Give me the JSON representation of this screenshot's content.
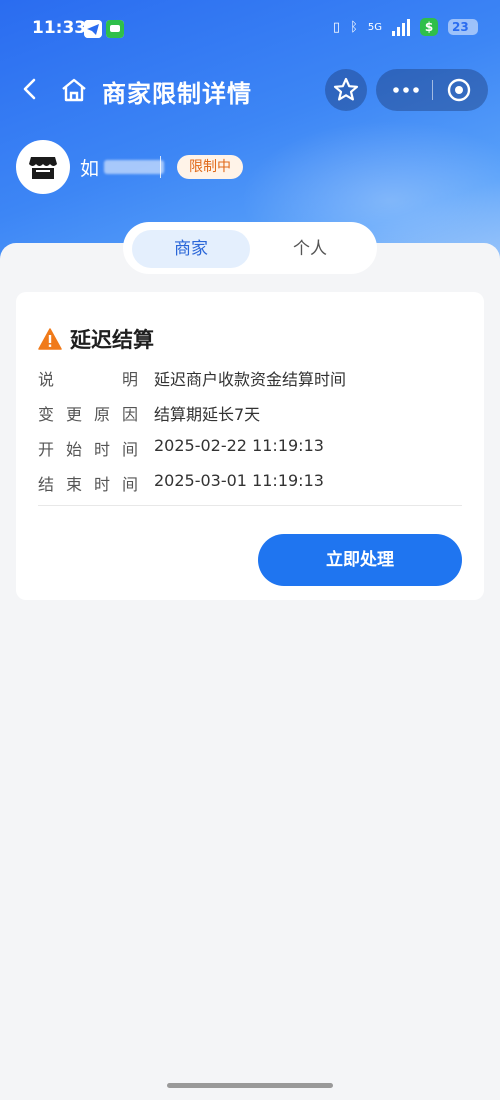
{
  "status": {
    "time": "11:33",
    "network": "5G",
    "battery": "23"
  },
  "nav": {
    "title": "商家限制详情"
  },
  "merchant": {
    "name_initial": "如",
    "restriction_tag": "限制中"
  },
  "tabs": [
    {
      "label": "商家",
      "active": true
    },
    {
      "label": "个人",
      "active": false
    }
  ],
  "card": {
    "title": "延迟结算",
    "rows": [
      {
        "label": [
          "说",
          "明"
        ],
        "value": "延迟商户收款资金结算时间"
      },
      {
        "label": [
          "变",
          "更",
          "原",
          "因"
        ],
        "value": "结算期延长7天"
      },
      {
        "label": [
          "开",
          "始",
          "时",
          "间"
        ],
        "value": "2025-02-22 11:19:13"
      },
      {
        "label": [
          "结",
          "束",
          "时",
          "间"
        ],
        "value": "2025-03-01 11:19:13"
      }
    ],
    "action_label": "立即处理"
  },
  "colors": {
    "primary": "#1f75f0",
    "warning": "#f07a1a",
    "tag_text": "#e06a1a"
  }
}
